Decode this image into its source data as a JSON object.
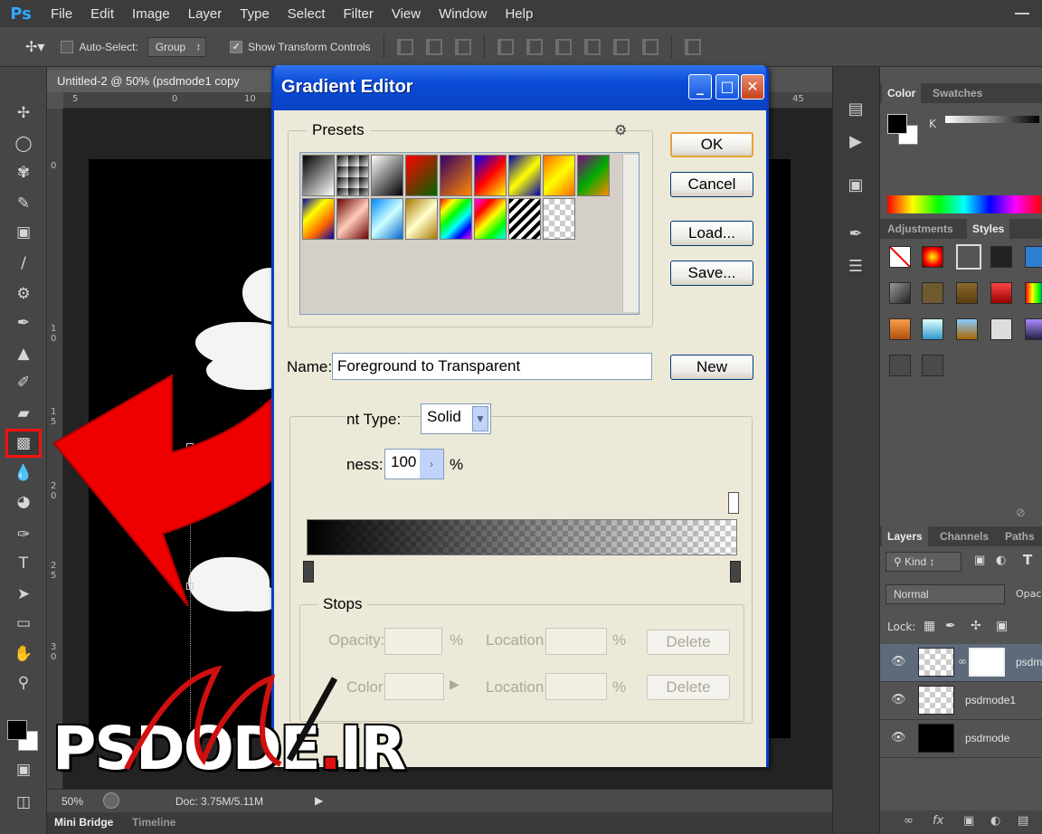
{
  "app": {
    "logo": "Ps",
    "menu": [
      "File",
      "Edit",
      "Image",
      "Layer",
      "Type",
      "Select",
      "Filter",
      "View",
      "Window",
      "Help"
    ]
  },
  "options": {
    "auto_select_label": "Auto-Select:",
    "auto_select_value": "Group",
    "show_transform_label": "Show Transform Controls"
  },
  "document": {
    "tab_title": "Untitled-2 @ 50% (psdmode1 copy",
    "ruler_top": [
      "5",
      "0",
      "5",
      "10",
      "45"
    ],
    "ruler_left": [
      "0",
      "1 0",
      "1 5",
      "2 0",
      "2 5",
      "3 0"
    ],
    "zoom": "50%",
    "doc_info": "Doc: 3.75M/5.11M"
  },
  "bottom_tabs": [
    "Mini Bridge",
    "Timeline"
  ],
  "dialog": {
    "title": "Gradient Editor",
    "presets_label": "Presets",
    "buttons": {
      "ok": "OK",
      "cancel": "Cancel",
      "load": "Load...",
      "save": "Save...",
      "new": "New"
    },
    "name_label": "Name:",
    "name_value": "Foreground to Transparent",
    "gradient_type_label": "nt Type:",
    "gradient_type_value": "Solid",
    "smoothness_label": "ness:",
    "smoothness_value": "100",
    "percent": "%",
    "stops": {
      "label": "Stops",
      "opacity_label": "Opacity:",
      "color_label": "Color:",
      "location_label": "Location:",
      "delete_label": "Delete"
    }
  },
  "panels": {
    "color_tabs": [
      "Color",
      "Swatches"
    ],
    "color_channel": "K",
    "adjust_tabs": [
      "Adjustments",
      "Styles"
    ],
    "layer_tabs": [
      "Layers",
      "Channels",
      "Paths"
    ],
    "kind_label": "Kind",
    "blend_mode": "Normal",
    "opacity_label": "Opaci",
    "lock_label": "Lock:",
    "layers": [
      {
        "name": "psdm",
        "has_mask": true
      },
      {
        "name": "psdmode1",
        "has_mask": false
      },
      {
        "name": "psdmode",
        "has_mask": false
      }
    ]
  },
  "watermark": {
    "text_left": "PSD",
    "text_mid": "ODE",
    "dot": ".",
    "text_right": "IR",
    "script": "M"
  },
  "colors": {
    "accent_red": "#ff1010",
    "xp_blue": "#0a4ad6",
    "ps_panel": "#535353"
  }
}
